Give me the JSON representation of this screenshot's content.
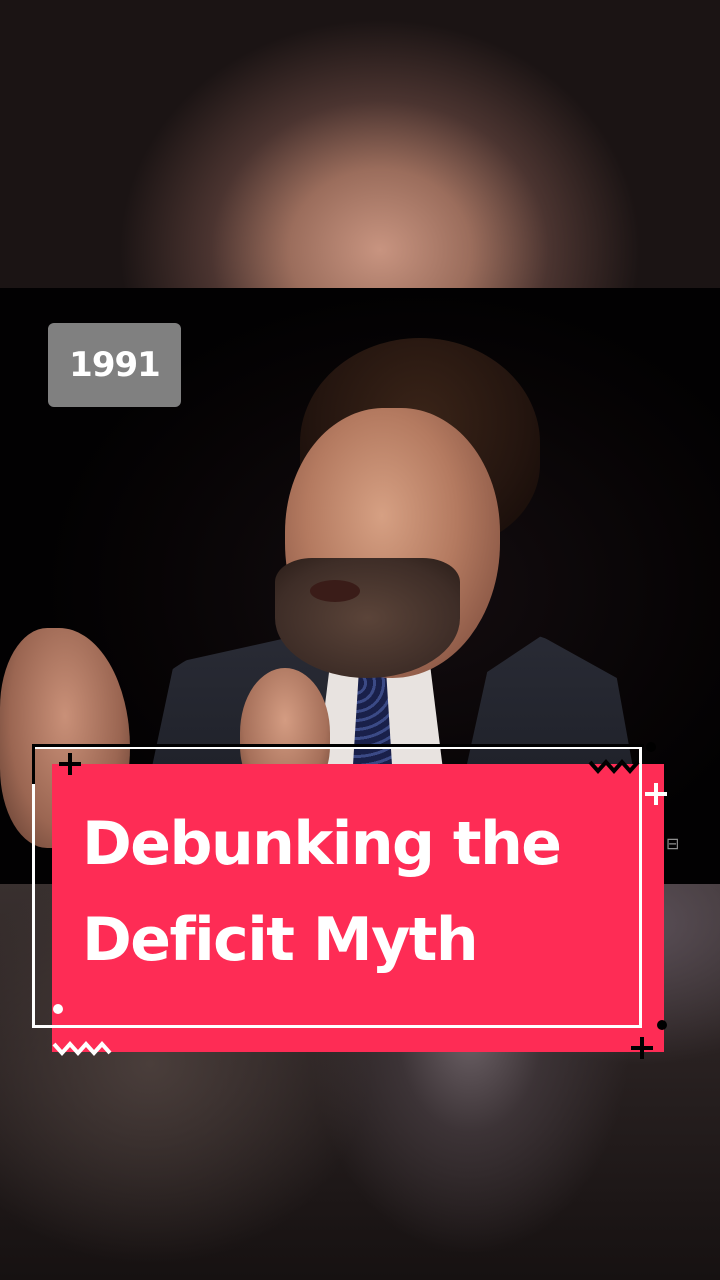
{
  "video": {
    "year_label": "1991"
  },
  "title_card": {
    "line1": "Debunking the",
    "line2": "Deficit Myth",
    "accent_color": "#fe2c55",
    "text_color": "#ffffff"
  },
  "icons": {
    "plus": "plus-icon",
    "zigzag": "zigzag-icon",
    "dot": "dot-icon"
  }
}
